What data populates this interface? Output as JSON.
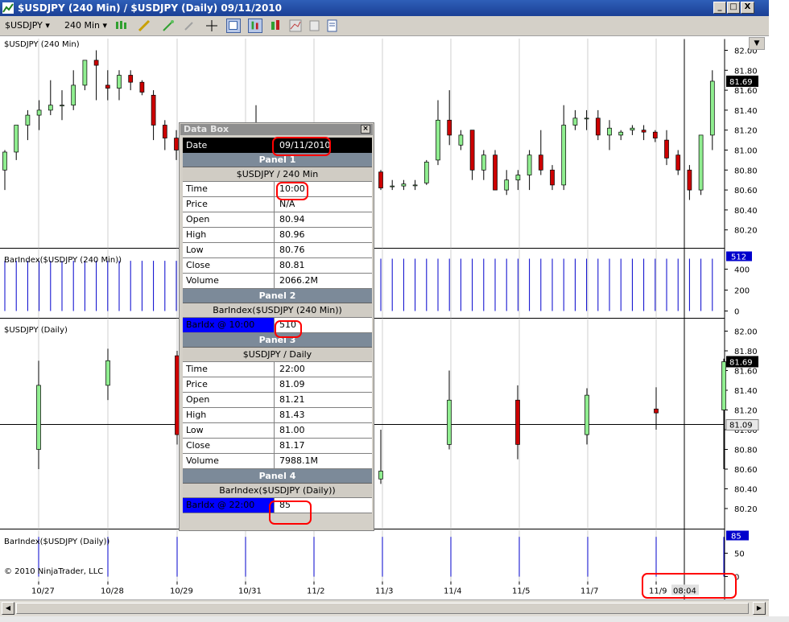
{
  "window": {
    "title": "$USDJPY (240 Min) / $USDJPY (Daily)  09/11/2010",
    "controls": [
      "_",
      "□",
      "X"
    ]
  },
  "toolbar": {
    "instrument": "$USDJPY",
    "interval": "240 Min"
  },
  "panes": {
    "p1_label": "$USDJPY (240 Min)",
    "p2_label": "BarIndex($USDJPY (240 Min))",
    "p3_label": "$USDJPY (Daily)",
    "p4_label": "BarIndex($USDJPY (Daily))"
  },
  "copyright": "© 2010 NinjaTrader, LLC",
  "axes": {
    "p1_ticks": [
      "82.00",
      "81.80",
      "81.60",
      "81.40",
      "81.20",
      "81.00",
      "80.80",
      "80.60",
      "80.40",
      "80.20"
    ],
    "p1_marker": "81.69",
    "p2_ticks": [
      "400",
      "200",
      "0"
    ],
    "p2_marker": "512",
    "p3_ticks": [
      "82.00",
      "81.80",
      "81.60",
      "81.40",
      "81.20",
      "81.00",
      "80.80",
      "80.60",
      "80.40",
      "80.20"
    ],
    "p3_marker_top": "81.69",
    "p3_marker_cross": "81.09",
    "p4_ticks": [
      "50",
      "0"
    ],
    "p4_marker": "85",
    "x_ticks": [
      "10/27",
      "10/28",
      "10/29",
      "10/31",
      "11/2",
      "11/3",
      "11/4",
      "11/5",
      "11/7",
      "11/9"
    ],
    "x_cursor": "08:04"
  },
  "databox": {
    "title": "Data Box",
    "date_label": "Date",
    "date_value": "09/11/2010",
    "panel1": "Panel 1",
    "panel1_sub": "$USDJPY / 240 Min",
    "panel1_rows": [
      {
        "k": "Time",
        "v": "10:00"
      },
      {
        "k": "Price",
        "v": "N/A"
      },
      {
        "k": "Open",
        "v": "80.94"
      },
      {
        "k": "High",
        "v": "80.96"
      },
      {
        "k": "Low",
        "v": "80.76"
      },
      {
        "k": "Close",
        "v": "80.81"
      },
      {
        "k": "Volume",
        "v": "2066.2M"
      }
    ],
    "panel2": "Panel 2",
    "panel2_sub": "BarIndex($USDJPY (240 Min))",
    "panel2_row": {
      "k": "BarIdx @ 10:00",
      "v": "510"
    },
    "panel3": "Panel 3",
    "panel3_sub": "$USDJPY / Daily",
    "panel3_rows": [
      {
        "k": "Time",
        "v": "22:00"
      },
      {
        "k": "Price",
        "v": "81.09"
      },
      {
        "k": "Open",
        "v": "81.21"
      },
      {
        "k": "High",
        "v": "81.43"
      },
      {
        "k": "Low",
        "v": "81.00"
      },
      {
        "k": "Close",
        "v": "81.17"
      },
      {
        "k": "Volume",
        "v": "7988.1M"
      }
    ],
    "panel4": "Panel 4",
    "panel4_sub": "BarIndex($USDJPY (Daily))",
    "panel4_row": {
      "k": "BarIdx @ 22:00",
      "v": "85"
    }
  },
  "chart_data": [
    {
      "type": "candlestick",
      "title": "$USDJPY (240 Min)",
      "y_ticks": [
        82.0,
        81.8,
        81.6,
        81.4,
        81.2,
        81.0,
        80.8,
        80.6,
        80.4,
        80.2
      ],
      "last_value": 81.69,
      "bars": [
        {
          "o": 80.8,
          "h": 81.0,
          "l": 80.6,
          "c": 80.98
        },
        {
          "o": 80.98,
          "h": 81.2,
          "l": 80.9,
          "c": 81.25
        },
        {
          "o": 81.25,
          "h": 81.4,
          "l": 81.1,
          "c": 81.35
        },
        {
          "o": 81.35,
          "h": 81.5,
          "l": 81.2,
          "c": 81.4
        },
        {
          "o": 81.4,
          "h": 81.7,
          "l": 81.35,
          "c": 81.45
        },
        {
          "o": 81.45,
          "h": 81.6,
          "l": 81.3,
          "c": 81.45
        },
        {
          "o": 81.45,
          "h": 81.8,
          "l": 81.4,
          "c": 81.65
        },
        {
          "o": 81.65,
          "h": 81.9,
          "l": 81.6,
          "c": 81.9
        },
        {
          "o": 81.9,
          "h": 82.0,
          "l": 81.5,
          "c": 81.85
        },
        {
          "o": 81.65,
          "h": 81.8,
          "l": 81.5,
          "c": 81.62
        },
        {
          "o": 81.62,
          "h": 81.8,
          "l": 81.5,
          "c": 81.75
        },
        {
          "o": 81.75,
          "h": 81.8,
          "l": 81.6,
          "c": 81.68
        },
        {
          "o": 81.68,
          "h": 81.7,
          "l": 81.55,
          "c": 81.58
        },
        {
          "o": 81.55,
          "h": 81.6,
          "l": 81.1,
          "c": 81.25
        },
        {
          "o": 81.25,
          "h": 81.3,
          "l": 81.0,
          "c": 81.12
        },
        {
          "o": 81.12,
          "h": 81.2,
          "l": 80.9,
          "c": 81.0
        },
        {
          "o": 81.05,
          "h": 81.1,
          "l": 80.95,
          "c": 81.0
        }
      ],
      "bars_right": [
        {
          "o": 80.78,
          "h": 80.8,
          "l": 80.6,
          "c": 80.62
        },
        {
          "o": 80.64,
          "h": 80.7,
          "l": 80.6,
          "c": 80.64
        },
        {
          "o": 80.64,
          "h": 80.7,
          "l": 80.6,
          "c": 80.66
        },
        {
          "o": 80.65,
          "h": 80.7,
          "l": 80.6,
          "c": 80.65
        },
        {
          "o": 80.67,
          "h": 80.9,
          "l": 80.65,
          "c": 80.88
        },
        {
          "o": 80.9,
          "h": 81.5,
          "l": 80.85,
          "c": 81.3
        },
        {
          "o": 81.3,
          "h": 81.6,
          "l": 81.05,
          "c": 81.15
        },
        {
          "o": 81.05,
          "h": 81.2,
          "l": 81.0,
          "c": 81.15
        },
        {
          "o": 81.2,
          "h": 81.2,
          "l": 80.7,
          "c": 80.8
        },
        {
          "o": 80.8,
          "h": 81.0,
          "l": 80.7,
          "c": 80.95
        },
        {
          "o": 80.95,
          "h": 81.0,
          "l": 80.6,
          "c": 80.6
        },
        {
          "o": 80.6,
          "h": 80.8,
          "l": 80.55,
          "c": 80.7
        },
        {
          "o": 80.7,
          "h": 80.8,
          "l": 80.6,
          "c": 80.75
        },
        {
          "o": 80.75,
          "h": 81.0,
          "l": 80.6,
          "c": 80.95
        },
        {
          "o": 80.95,
          "h": 81.2,
          "l": 80.75,
          "c": 80.8
        },
        {
          "o": 80.8,
          "h": 80.85,
          "l": 80.6,
          "c": 80.65
        },
        {
          "o": 80.65,
          "h": 81.45,
          "l": 80.6,
          "c": 81.25
        },
        {
          "o": 81.25,
          "h": 81.4,
          "l": 81.2,
          "c": 81.32
        },
        {
          "o": 81.32,
          "h": 81.4,
          "l": 81.2,
          "c": 81.32
        },
        {
          "o": 81.32,
          "h": 81.4,
          "l": 81.1,
          "c": 81.15
        },
        {
          "o": 81.15,
          "h": 81.3,
          "l": 81.0,
          "c": 81.22
        },
        {
          "o": 81.15,
          "h": 81.2,
          "l": 81.1,
          "c": 81.18
        },
        {
          "o": 81.2,
          "h": 81.25,
          "l": 81.15,
          "c": 81.22
        },
        {
          "o": 81.2,
          "h": 81.25,
          "l": 81.1,
          "c": 81.18
        },
        {
          "o": 81.18,
          "h": 81.2,
          "l": 81.08,
          "c": 81.12
        },
        {
          "o": 81.1,
          "h": 81.2,
          "l": 80.85,
          "c": 80.92
        },
        {
          "o": 80.95,
          "h": 81.0,
          "l": 80.75,
          "c": 80.8
        },
        {
          "o": 80.8,
          "h": 80.85,
          "l": 80.5,
          "c": 80.6
        },
        {
          "o": 80.6,
          "h": 81.15,
          "l": 80.55,
          "c": 81.15
        },
        {
          "o": 81.15,
          "h": 81.8,
          "l": 81.0,
          "c": 81.69
        }
      ]
    },
    {
      "type": "bar",
      "title": "BarIndex($USDJPY (240 Min))",
      "y_ticks": [
        400,
        200,
        0
      ],
      "last_value": 512
    },
    {
      "type": "candlestick",
      "title": "$USDJPY (Daily)",
      "y_ticks": [
        82.0,
        81.8,
        81.6,
        81.4,
        81.2,
        81.0,
        80.8,
        80.6,
        80.4,
        80.2
      ],
      "last_value": 81.69,
      "crosshair_value": 81.09
    },
    {
      "type": "bar",
      "title": "BarIndex($USDJPY (Daily))",
      "y_ticks": [
        50,
        0
      ],
      "last_value": 85
    }
  ],
  "colors": {
    "up": "#90ee90",
    "down": "#cc0000",
    "index_bar": "#0000cc",
    "titlebar": "#1f4ea3"
  }
}
